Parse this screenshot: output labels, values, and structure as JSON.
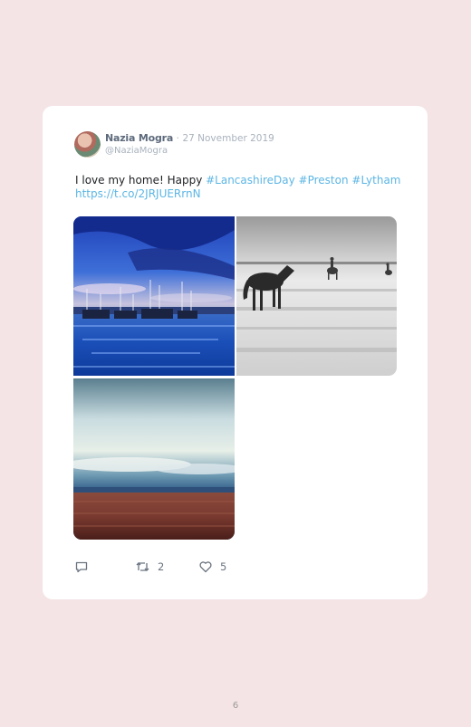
{
  "tweet": {
    "author_name": "Nazia Mogra",
    "separator": "·",
    "date": "27 November 2019",
    "handle": "@NaziaMogra",
    "text_prefix": "I love my home! Happy ",
    "hashtags": [
      "#LancashireDay",
      "#Preston",
      "#Lytham"
    ],
    "url": "https://t.co/2JRJUERrnN",
    "photo_icons": [
      "marina-photo",
      "horses-beach-photo",
      "beach-sky-photo"
    ],
    "actions": {
      "reply_icon": "reply-icon",
      "retweet_icon": "retweet-icon",
      "retweet_count": "2",
      "like_icon": "heart-icon",
      "like_count": "5"
    }
  },
  "page": {
    "number": "6"
  },
  "colors": {
    "background": "#f5e4e5",
    "card": "#ffffff",
    "link": "#5cb6e4"
  }
}
